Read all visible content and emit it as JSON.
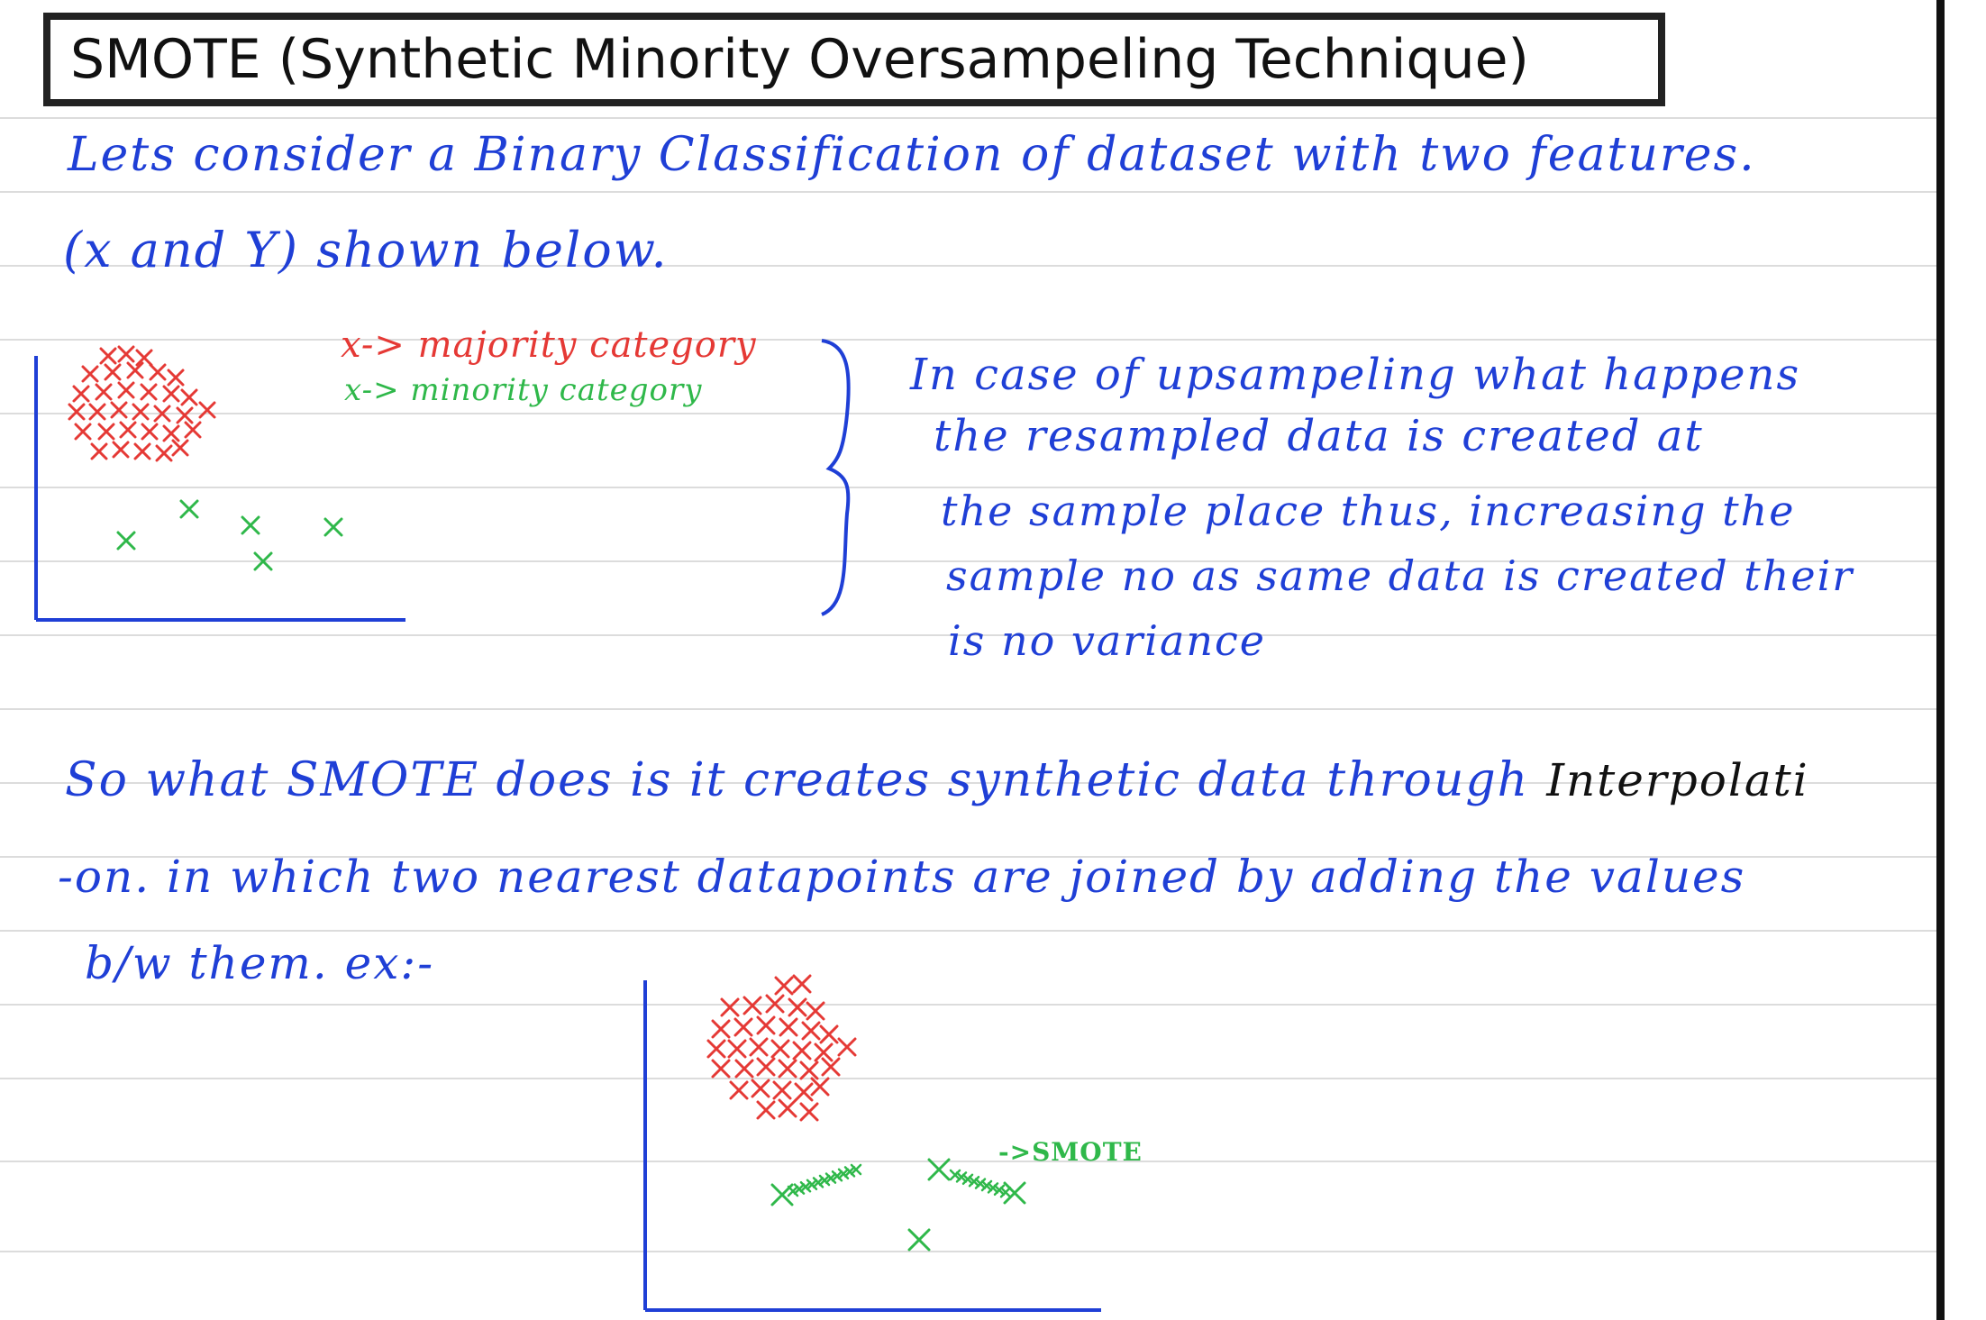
{
  "title": "SMOTE (Synthetic Minority Oversampeling Technique)",
  "intro": {
    "line1": "Lets consider a Binary Classification of dataset with two features.",
    "line2": "(x and Y) shown below."
  },
  "legend": {
    "majority": "x-> majority category",
    "minority": "x-> minority category"
  },
  "upsampling_note": {
    "line1": "In case of upsampeling what happens",
    "line2": "the resampled data is created at",
    "line3": "the sample place thus, increasing the",
    "line4": "sample no as same data is created their",
    "line5": "is no variance"
  },
  "smote_note": {
    "line1_main": "So what SMOTE does is it creates synthetic data through",
    "line1_end": "Interpolati",
    "line2": "-on. in which two nearest datapoints are joined by adding the values",
    "line3": "b/w them. ex:-"
  },
  "smote_label": "->SMOTE",
  "colors": {
    "ink_blue": "#1f3fd6",
    "majority_red": "#e53935",
    "minority_green": "#2fb84a"
  }
}
